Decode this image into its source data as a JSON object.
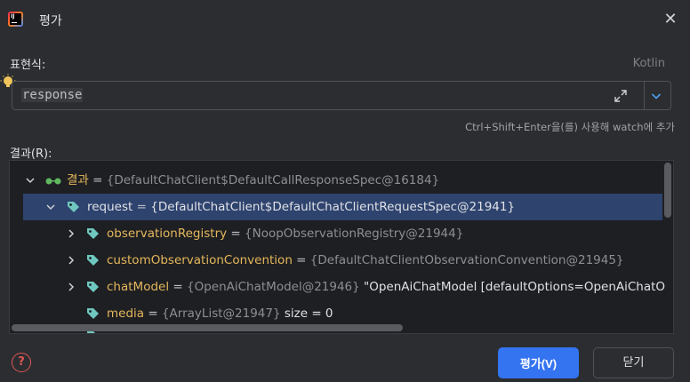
{
  "dialog": {
    "title": "평가",
    "close_symbol": "✕"
  },
  "expression": {
    "label": "표현식:",
    "language": "Kotlin",
    "value": "response",
    "hint": "Ctrl+Shift+Enter을(를) 사용해 watch에 추가"
  },
  "result": {
    "label": "결과(R):",
    "rows": [
      {
        "name": "결과",
        "eq": " = ",
        "value": "{DefaultChatClient$DefaultCallResponseSpec@16184}",
        "extra": ""
      },
      {
        "name": "request",
        "eq": " = ",
        "value": "{DefaultChatClient$DefaultChatClientRequestSpec@21941}",
        "extra": ""
      },
      {
        "name": "observationRegistry",
        "eq": " = ",
        "value": "{NoopObservationRegistry@21944}",
        "extra": ""
      },
      {
        "name": "customObservationConvention",
        "eq": " = ",
        "value": "{DefaultChatClientObservationConvention@21945}",
        "extra": ""
      },
      {
        "name": "chatModel",
        "eq": " = ",
        "value": "{OpenAiChatModel@21946}",
        "extra": " \"OpenAiChatModel [defaultOptions=OpenAiChatO"
      },
      {
        "name": "media",
        "eq": " = ",
        "value": "{ArrayList@21947}",
        "extra": "  size = 0"
      }
    ]
  },
  "buttons": {
    "help": "?",
    "evaluate": "평가(V)",
    "close": "닫기"
  },
  "colors": {
    "accent": "#3574f0",
    "selection": "#2e436e",
    "field_name": "#e5b75c",
    "tag_icon": "#6fc8c0"
  }
}
